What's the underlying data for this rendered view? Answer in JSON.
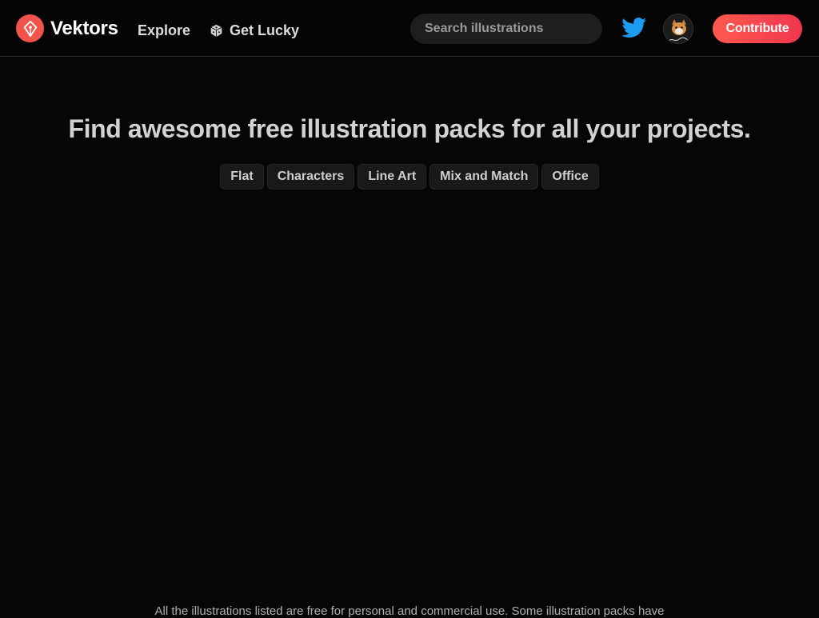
{
  "header": {
    "brand": "Vektors",
    "nav": {
      "explore": "Explore",
      "lucky": "Get Lucky"
    },
    "search": {
      "placeholder": "Search illustrations",
      "value": ""
    },
    "contribute_label": "Contribute"
  },
  "hero": {
    "title": "Find awesome free illustration packs for all your projects.",
    "tags": [
      "Flat",
      "Characters",
      "Line Art",
      "Mix and Match",
      "Office"
    ]
  },
  "footer": {
    "note": "All the illustrations listed are free for personal and commercial use. Some illustration packs have"
  },
  "colors": {
    "accent": "#f2544d",
    "background": "#060606",
    "twitter": "#1d9bf0"
  },
  "icons": [
    "vektors-logo-icon",
    "dice-icon",
    "search-icon",
    "twitter-icon",
    "avatar-image"
  ]
}
